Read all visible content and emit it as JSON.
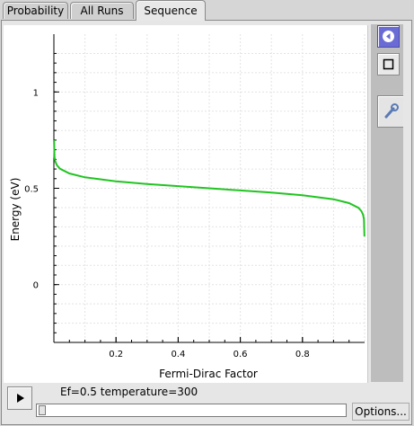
{
  "tabs": [
    {
      "label": "Probability",
      "active": false
    },
    {
      "label": "All Runs",
      "active": false
    },
    {
      "label": "Sequence",
      "active": true
    }
  ],
  "status_text": "Ef=0.5 temperature=300",
  "options_label": "Options...",
  "slider": {
    "value": 0
  },
  "colors": {
    "curve": "#22c422",
    "accent": "#6b6bd6"
  },
  "chart_data": {
    "type": "line",
    "xlabel": "Fermi-Dirac Factor",
    "ylabel": "Energy (eV)",
    "xlim": [
      0.0,
      1.0
    ],
    "ylim": [
      -0.3,
      1.3
    ],
    "xticks": [
      {
        "v": 0.2,
        "label": "0.2"
      },
      {
        "v": 0.4,
        "label": "0.4"
      },
      {
        "v": 0.6,
        "label": "0.6"
      },
      {
        "v": 0.8,
        "label": "0.8"
      }
    ],
    "yticks": [
      {
        "v": 0,
        "label": "0"
      },
      {
        "v": 0.5,
        "label": "0.5"
      },
      {
        "v": 1,
        "label": "1"
      }
    ],
    "grid": true,
    "series": [
      {
        "x": [
          0.0005,
          0.002,
          0.005,
          0.01,
          0.02,
          0.05,
          0.1,
          0.2,
          0.3,
          0.4,
          0.5,
          0.6,
          0.7,
          0.8,
          0.9,
          0.95,
          0.98,
          0.99,
          0.995,
          0.998,
          0.9995
        ],
        "y": [
          0.75,
          0.661,
          0.637,
          0.619,
          0.601,
          0.577,
          0.557,
          0.536,
          0.522,
          0.511,
          0.5,
          0.489,
          0.478,
          0.464,
          0.443,
          0.423,
          0.399,
          0.381,
          0.363,
          0.339,
          0.25
        ]
      }
    ]
  }
}
